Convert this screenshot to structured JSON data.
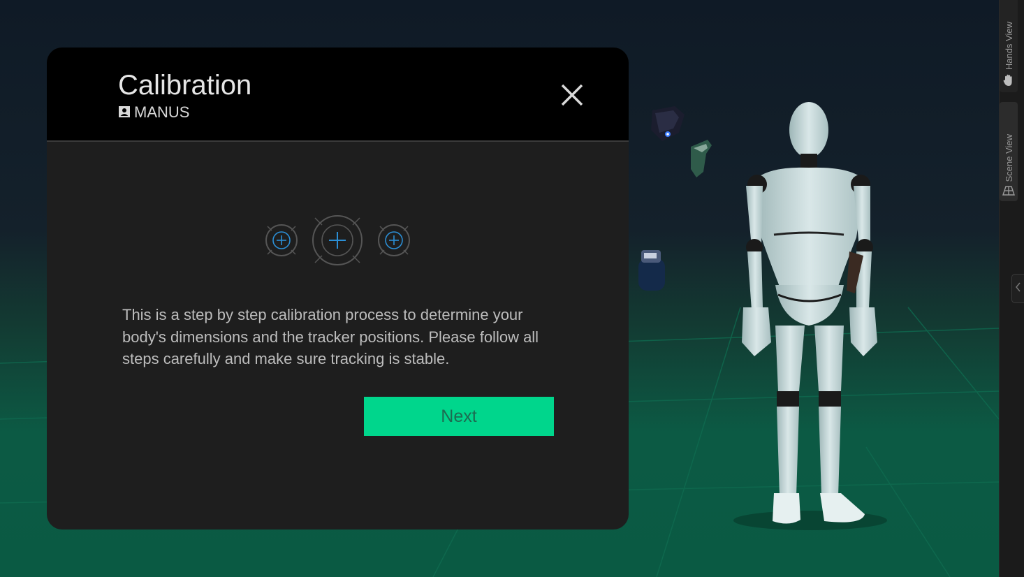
{
  "dialog": {
    "title": "Calibration",
    "subtitle": "MANUS",
    "description": "This is a step by step calibration process to determine your body's dimensions and the tracker positions. Please follow all steps carefully and make sure tracking is stable.",
    "next_label": "Next"
  },
  "side_panel": {
    "tabs": [
      {
        "label": "Hands View",
        "icon": "hand-icon"
      },
      {
        "label": "Scene View",
        "icon": "scene-icon"
      }
    ]
  },
  "colors": {
    "accent": "#00d68c",
    "dialog_bg": "#1e1e1e",
    "header_bg": "#000000",
    "crosshair_accent": "#2b8fd6"
  }
}
